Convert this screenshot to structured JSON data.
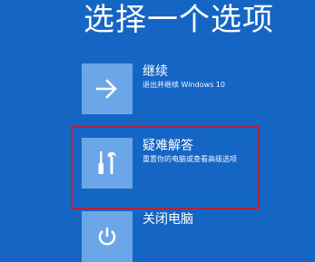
{
  "screen": {
    "title": "选择一个选项"
  },
  "options": [
    {
      "id": "continue",
      "title": "继续",
      "description": "退出并继续 Windows 10",
      "icon": "arrow-right-icon"
    },
    {
      "id": "troubleshoot",
      "title": "疑难解答",
      "description": "重置你的电脑或查看高级选项",
      "icon": "tools-icon",
      "highlighted": true
    },
    {
      "id": "shutdown",
      "title": "关闭电脑",
      "description": "",
      "icon": "power-icon"
    }
  ],
  "colors": {
    "background": "#1565c5",
    "tile": "#6aa6e8",
    "highlight_border": "#b5223a",
    "text": "#ffffff"
  }
}
